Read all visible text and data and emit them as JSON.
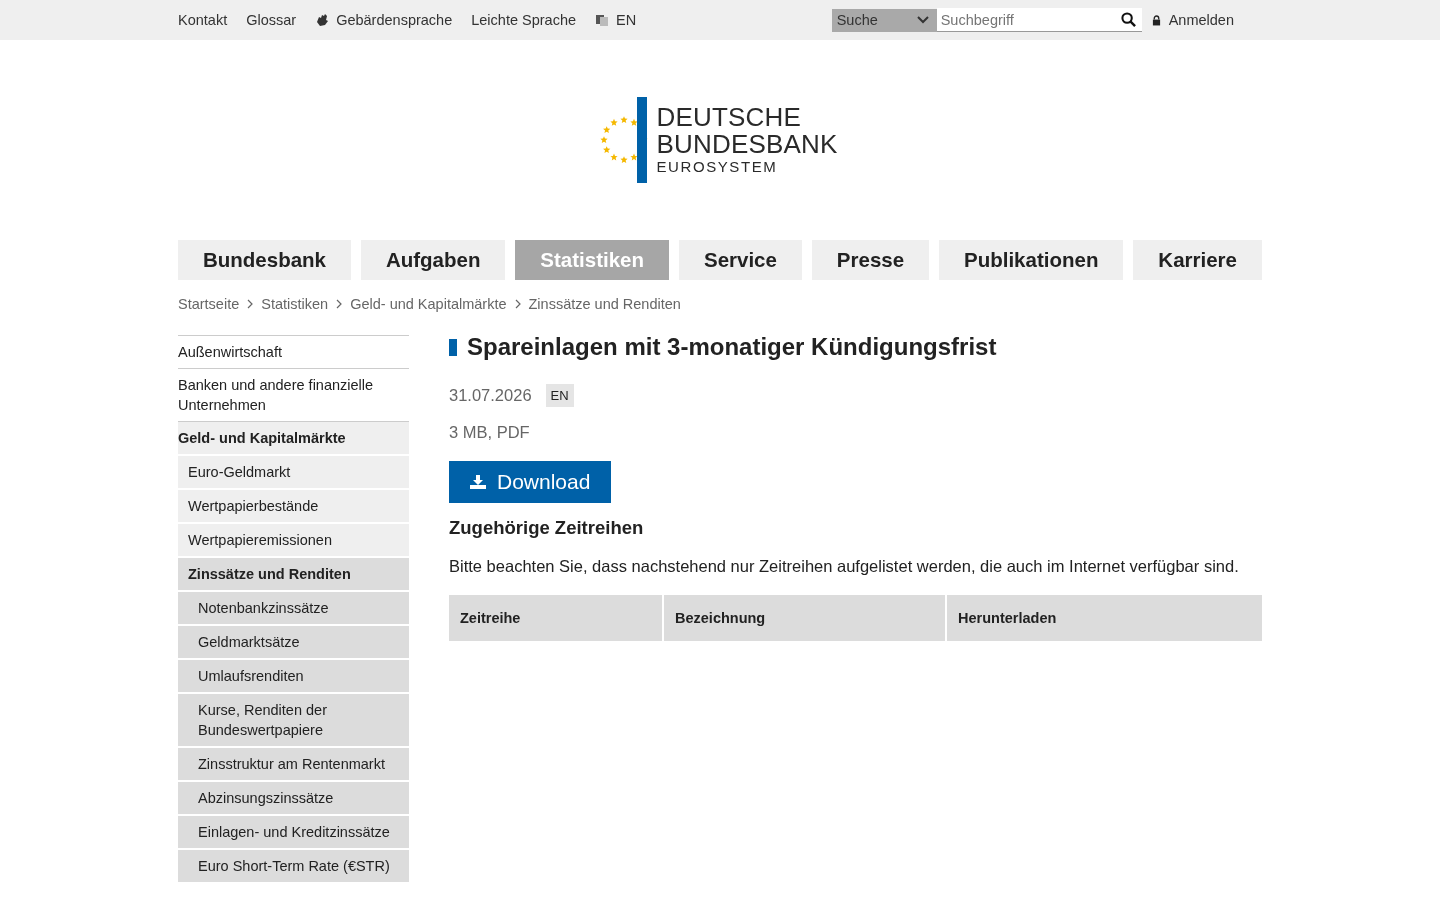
{
  "top_bar": {
    "links": [
      {
        "label": "Kontakt",
        "kind": "text"
      },
      {
        "label": "Glossar",
        "kind": "text"
      },
      {
        "label": "Gebärdensprache",
        "kind": "sign"
      },
      {
        "label": "Leichte Sprache",
        "kind": "text"
      },
      {
        "label": "EN",
        "kind": "language"
      }
    ],
    "search_scope": "Suche",
    "search": {
      "placeholder": "Suchbegriff"
    },
    "login": "Anmelden"
  },
  "logo": {
    "line_1": "DEUTSCHE",
    "line_2": "BUNDESBANK",
    "line_3": "EUROSYSTEM"
  },
  "nav": [
    {
      "label": "Bundesbank",
      "selected": false
    },
    {
      "label": "Aufgaben",
      "selected": false
    },
    {
      "label": "Statistiken",
      "selected": true
    },
    {
      "label": "Service",
      "selected": false
    },
    {
      "label": "Presse",
      "selected": false
    },
    {
      "label": "Publikationen",
      "selected": false
    },
    {
      "label": "Karriere",
      "selected": false
    }
  ],
  "breadcrumb": [
    "Startseite",
    "Statistiken",
    "Geld- und Kapitalmärkte",
    "Zinssätze und Renditen"
  ],
  "sidebar": {
    "items": [
      {
        "label": "Außenwirtschaft",
        "expanded": false
      },
      {
        "label": "Banken und andere finanzielle Unternehmen",
        "expanded": false
      },
      {
        "label": "Geld- und Kapitalmärkte",
        "expanded": true,
        "children": [
          {
            "label": "Euro-Geldmarkt",
            "expanded": false
          },
          {
            "label": "Wertpapierbestände",
            "expanded": false
          },
          {
            "label": "Wertpapieremissionen",
            "expanded": false
          },
          {
            "label": "Zinssätze und Renditen",
            "expanded": true,
            "children": [
              {
                "label": "Notenbankzinssätze",
                "expanded": false
              },
              {
                "label": "Geldmarktsätze",
                "expanded": false
              },
              {
                "label": "Umlaufsrenditen",
                "expanded": false
              },
              {
                "label": "Kurse, Renditen der Bundeswertpapiere",
                "expanded": false
              },
              {
                "label": "Zinsstruktur am Rentenmarkt",
                "expanded": false
              },
              {
                "label": "Abzinsungszinssätze",
                "expanded": false
              },
              {
                "label": "Einlagen- und Kreditzinssätze",
                "expanded": false
              },
              {
                "label": "Euro Short-Term Rate (€STR)",
                "expanded": false
              }
            ]
          }
        ]
      }
    ]
  },
  "article": {
    "title": "Spareinlagen mit 3-monatiger Kündigungsfrist",
    "date": "31.07.2026",
    "language_badge": "EN",
    "file_info": "3 MB, PDF",
    "download_button": "Download",
    "section_title": "Zugehörige Zeitreihen",
    "note": "Bitte beachten Sie, dass nachstehend nur Zeitreihen aufgelistet werden, die auch im Internet verfügbar sind.",
    "table": {
      "columns": [
        "Zeitreihe",
        "Bezeichnung",
        "Herunterladen"
      ]
    }
  }
}
